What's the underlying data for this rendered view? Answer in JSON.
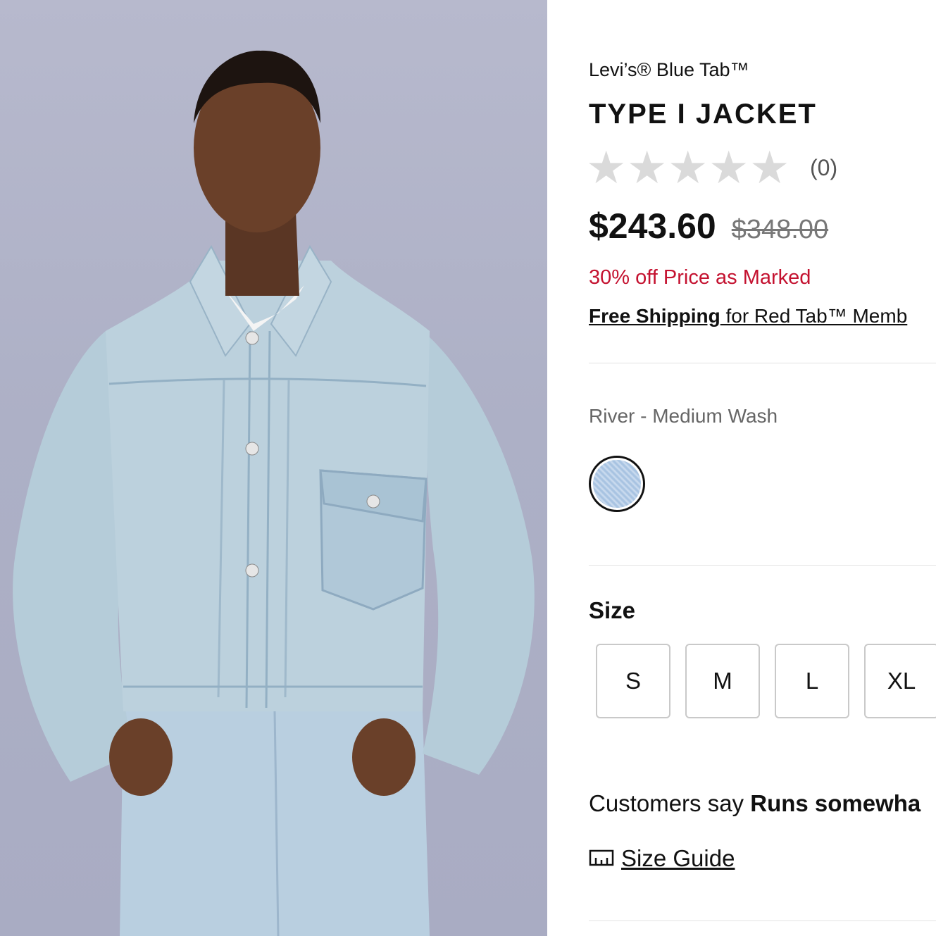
{
  "product": {
    "brand": "Levi’s® Blue Tab™",
    "title": "TYPE I JACKET",
    "rating": {
      "stars_filled": 0,
      "stars_total": 5,
      "count": "(0)"
    },
    "price": {
      "current": "$243.60",
      "original": "$348.00"
    },
    "promo": "30% off Price as Marked",
    "shipping": {
      "link": "Free Shipping",
      "rest": " for Red Tab™ Memb"
    },
    "color": {
      "name": "River - Medium Wash"
    },
    "size": {
      "label": "Size",
      "options": [
        "S",
        "M",
        "L",
        "XL"
      ]
    },
    "fit": {
      "prefix": "Customers say ",
      "value": "Runs somewha"
    },
    "size_guide": "Size Guide"
  },
  "colors": {
    "promo": "#c41230",
    "photo_bg": "#b1b3c9",
    "denim": "#b3cbd9"
  }
}
